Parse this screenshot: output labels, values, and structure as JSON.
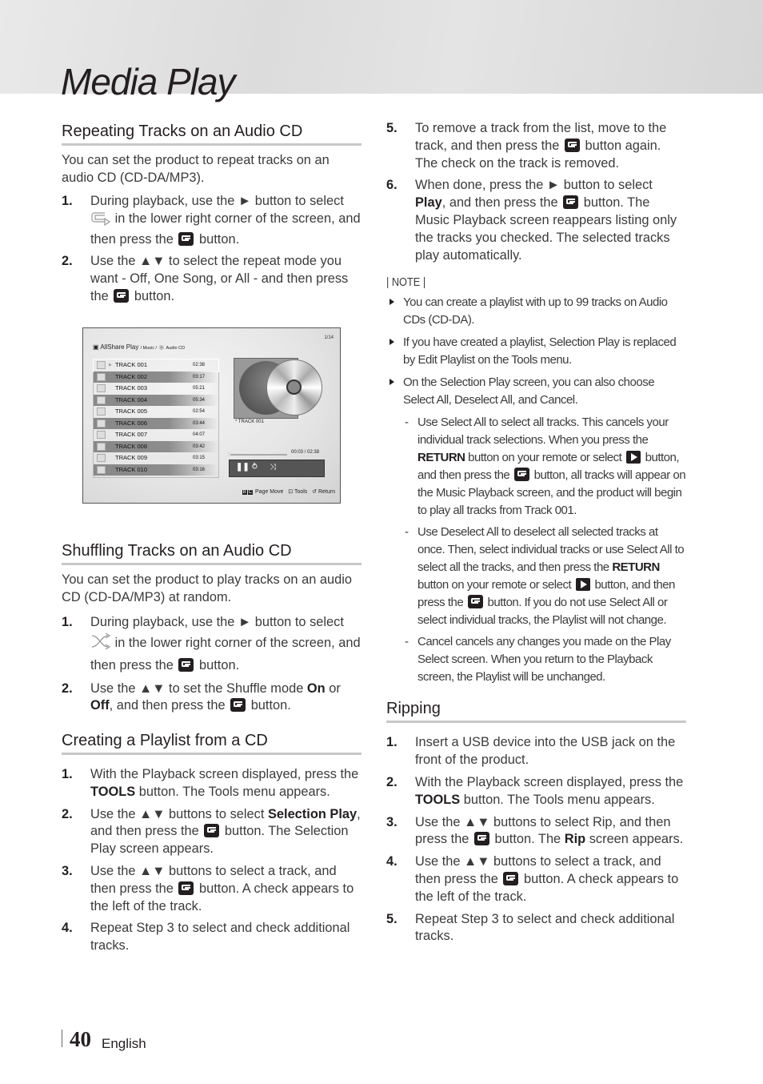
{
  "header": {
    "title": "Media Play"
  },
  "repeat": {
    "heading": "Repeating Tracks on an Audio CD",
    "intro": "You can set the product to repeat tracks on an audio CD (CD-DA/MP3).",
    "steps": [
      {
        "num": "1.",
        "a": "During playback, use the ► button to select",
        "b": "in the lower right corner of the screen, and then press the",
        "c": "button."
      },
      {
        "num": "2.",
        "a": "Use the ▲▼ to select the repeat mode you want - Off, One Song, or All - and then press the",
        "b": "button."
      }
    ]
  },
  "screen": {
    "page_indicator": "1/14",
    "app": "AllShare Play",
    "path1": "/ Music /",
    "path2": "Audio CD",
    "tracks": [
      {
        "name": "TRACK 001",
        "duration": "02:38"
      },
      {
        "name": "TRACK 002",
        "duration": "03:17"
      },
      {
        "name": "TRACK 003",
        "duration": "05:21"
      },
      {
        "name": "TRACK 004",
        "duration": "05:34"
      },
      {
        "name": "TRACK 005",
        "duration": "02:54"
      },
      {
        "name": "TRACK 006",
        "duration": "03:44"
      },
      {
        "name": "TRACK 007",
        "duration": "04:07"
      },
      {
        "name": "TRACK 008",
        "duration": "03:42"
      },
      {
        "name": "TRACK 009",
        "duration": "03:15"
      },
      {
        "name": "TRACK 010",
        "duration": "03:16"
      }
    ],
    "now_playing": "* TRACK 001",
    "timecode": "00:03 / 02:38",
    "progress_fraction": 0.02,
    "pause_icon": "❚❚",
    "repeat_icon": "⥁",
    "shuffle_icon": "⤨",
    "key_b": "B",
    "key_c": "C",
    "page_move": "Page Move",
    "tools": "Tools",
    "return": "Return"
  },
  "shuffle": {
    "heading": "Shuffling Tracks on an Audio CD",
    "intro": "You can set the product to play tracks on an audio CD (CD-DA/MP3) at random.",
    "steps": [
      {
        "num": "1.",
        "a": "During playback, use the ► button to select",
        "b": "in the lower right corner of the screen, and then press the",
        "c": "button."
      },
      {
        "num": "2.",
        "a": "Use the ▲▼ to set the Shuffle mode",
        "on": "On",
        "or": "or",
        "off": "Off",
        "b": ", and then press the",
        "c": "button."
      }
    ]
  },
  "playlist": {
    "heading": "Creating a Playlist from a CD",
    "steps": [
      {
        "num": "1.",
        "a": "With the Playback screen displayed, press the",
        "bold": "TOOLS",
        "b": "button. The Tools menu appears."
      },
      {
        "num": "2.",
        "a": "Use the ▲▼ buttons to select",
        "bold": "Selection Play",
        "b": ", and then press the",
        "c": "button. The Selection Play screen appears."
      },
      {
        "num": "3.",
        "a": "Use the ▲▼ buttons to select a track, and then press the",
        "b": "button. A check appears to the left of the track."
      },
      {
        "num": "4.",
        "a": "Repeat Step 3 to select and check additional tracks."
      },
      {
        "num": "5.",
        "a": "To remove a track from the list, move to the track, and then press the",
        "b": "button again. The check on the track is removed."
      },
      {
        "num": "6.",
        "a": "When done, press the ► button to select",
        "bold": "Play",
        "b": ", and then press the",
        "c": "button. The Music Playback screen reappears listing only the tracks you checked. The selected tracks play automatically."
      }
    ],
    "note_label": "| NOTE |",
    "notes": [
      "You can create a playlist with up to 99 tracks on Audio CDs (CD-DA).",
      "If you have created a playlist, Selection Play is replaced by Edit Playlist on the Tools menu.",
      "On the Selection Play screen, you can also choose Select All, Deselect All, and Cancel."
    ],
    "subnotes": [
      {
        "dash": "-",
        "a": "Use Select All to select all tracks. This cancels your individual track selections. When you press the",
        "bold": "RETURN",
        "b": "button on your remote or select",
        "c": "button, and then press the",
        "d": "button, all tracks will appear on the Music Playback screen, and the product will begin to play all tracks from Track 001."
      },
      {
        "dash": "-",
        "a": "Use Deselect All to deselect all selected tracks at once. Then, select individual tracks or use Select All to select all the tracks, and then press the",
        "bold": "RETURN",
        "b": "button on your remote or select",
        "c": "button, and then press the",
        "d": "button. If you do not use Select All or select individual tracks, the Playlist will not change."
      },
      {
        "dash": "-",
        "a": "Cancel cancels any changes you made on the Play Select screen. When you return to the Playback screen, the Playlist will be unchanged."
      }
    ]
  },
  "ripping": {
    "heading": "Ripping",
    "steps": [
      {
        "num": "1.",
        "a": "Insert a USB device into the USB jack on the front of the product."
      },
      {
        "num": "2.",
        "a": "With the Playback screen displayed, press the",
        "bold": "TOOLS",
        "b": "button. The Tools menu appears."
      },
      {
        "num": "3.",
        "a": "Use the ▲▼ buttons to select Rip, and then press the",
        "b": "button. The",
        "bold": "Rip",
        "c": "screen appears."
      },
      {
        "num": "4.",
        "a": "Use the ▲▼ buttons to select a track, and then press the",
        "b": "button. A check appears to the left of the track."
      },
      {
        "num": "5.",
        "a": "Repeat Step 3 to select and check additional tracks."
      }
    ]
  },
  "footer": {
    "page_number": "40",
    "language": "English"
  }
}
